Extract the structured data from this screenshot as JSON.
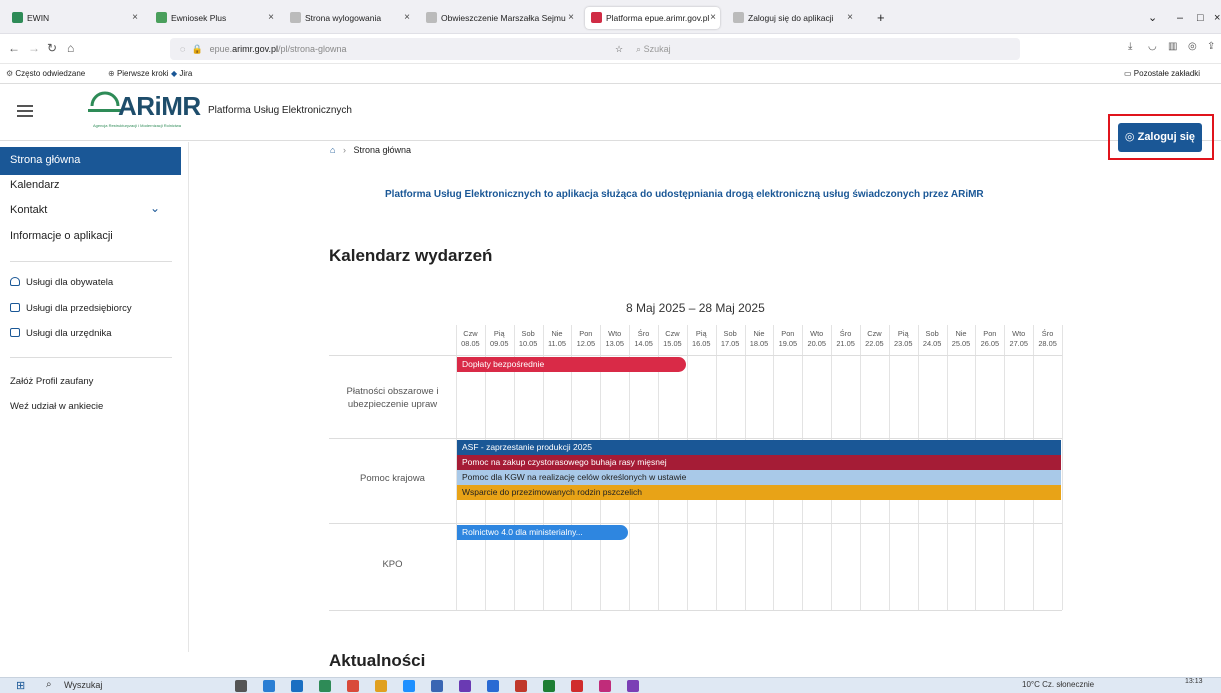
{
  "browser": {
    "tabs": [
      {
        "label": "EWIN",
        "color": "#2e8b57"
      },
      {
        "label": "Ewniosek Plus",
        "color": "#4a9f5c"
      },
      {
        "label": "Strona wylogowania",
        "color": "#bbbbbb"
      },
      {
        "label": "Obwieszczenie Marszałka Sejmu",
        "color": "#bbbbbb"
      },
      {
        "label": "Platforma epue.arimr.gov.pl",
        "color": "#d02c45"
      },
      {
        "label": "Zaloguj się do aplikacji",
        "color": "#bbbbbb"
      }
    ],
    "new_tab": "+",
    "url_prefix": "epue.",
    "url_domain": "arimr.gov.pl",
    "url_path": "/pl/strona-glowna",
    "search_placeholder": "Szukaj",
    "bookmarks": [
      "Często odwiedzane",
      "Pierwsze kroki",
      "Jira"
    ],
    "other_bookmarks": "Pozostałe zakładki"
  },
  "header": {
    "logo": "ARiMR",
    "logo_subtitle": "Agencja Restrukturyzacji i Modernizacji Rolnictwa",
    "platform_title": "Platforma Usług Elektronicznych",
    "login_label": "Zaloguj się"
  },
  "sidebar": {
    "items": [
      {
        "label": "Strona główna"
      },
      {
        "label": "Kalendarz"
      },
      {
        "label": "Kontakt"
      },
      {
        "label": "Informacje o aplikacji"
      }
    ],
    "services": [
      {
        "label": "Usługi dla obywatela"
      },
      {
        "label": "Usługi dla przedsiębiorcy"
      },
      {
        "label": "Usługi dla urzędnika"
      }
    ],
    "extra": [
      {
        "label": "Załóż Profil zaufany"
      },
      {
        "label": "Weź udział w ankiecie"
      }
    ]
  },
  "main": {
    "breadcrumb": "Strona główna",
    "tagline": "Platforma Usług Elektronicznych to aplikacja służąca do udostępniania drogą elektroniczną usług świadczonych przez ARiMR",
    "calendar_title": "Kalendarz wydarzeń",
    "range": "8 Maj 2025 – 28 Maj 2025",
    "news_title": "Aktualności",
    "days": [
      [
        "Czw",
        "08.05"
      ],
      [
        "Pią",
        "09.05"
      ],
      [
        "Sob",
        "10.05"
      ],
      [
        "Nie",
        "11.05"
      ],
      [
        "Pon",
        "12.05"
      ],
      [
        "Wto",
        "13.05"
      ],
      [
        "Śro",
        "14.05"
      ],
      [
        "Czw",
        "15.05"
      ],
      [
        "Pią",
        "16.05"
      ],
      [
        "Sob",
        "17.05"
      ],
      [
        "Nie",
        "18.05"
      ],
      [
        "Pon",
        "19.05"
      ],
      [
        "Wto",
        "20.05"
      ],
      [
        "Śro",
        "21.05"
      ],
      [
        "Czw",
        "22.05"
      ],
      [
        "Pią",
        "23.05"
      ],
      [
        "Sob",
        "24.05"
      ],
      [
        "Nie",
        "25.05"
      ],
      [
        "Pon",
        "26.05"
      ],
      [
        "Wto",
        "27.05"
      ],
      [
        "Śro",
        "28.05"
      ]
    ],
    "rows": [
      {
        "label": "Płatności obszarowe i ubezpieczenie upraw",
        "events": [
          {
            "label": "Dopłaty bezpośrednie",
            "start": 0,
            "span": 8,
            "color": "#d92a47",
            "text": "#ffffff",
            "rounded": true
          }
        ]
      },
      {
        "label": "Pomoc krajowa",
        "events": [
          {
            "label": "ASF - zaprzestanie produkcji 2025",
            "start": 0,
            "span": 21,
            "color": "#1a5796",
            "text": "#ffffff"
          },
          {
            "label": "Pomoc na zakup czystorasowego buhaja rasy mięsnej",
            "start": 0,
            "span": 21,
            "color": "#a51c36",
            "text": "#ffffff"
          },
          {
            "label": "Pomoc dla KGW na realizację celów określonych w ustawie",
            "start": 0,
            "span": 21,
            "color": "#a9c9e8",
            "text": "#222222"
          },
          {
            "label": "Wsparcie do przezimowanych rodzin pszczelich",
            "start": 0,
            "span": 21,
            "color": "#e8a317",
            "text": "#222222"
          }
        ]
      },
      {
        "label": "KPO",
        "events": [
          {
            "label": "Rolnictwo 4.0 dla ministerialny...",
            "start": 0,
            "span": 6,
            "color": "#2e86e0",
            "text": "#ffffff",
            "rounded": true
          }
        ]
      }
    ]
  },
  "taskbar": {
    "search": "Wyszukaj",
    "weather": "10°C Cz. słonecznie",
    "time": "13:13"
  }
}
